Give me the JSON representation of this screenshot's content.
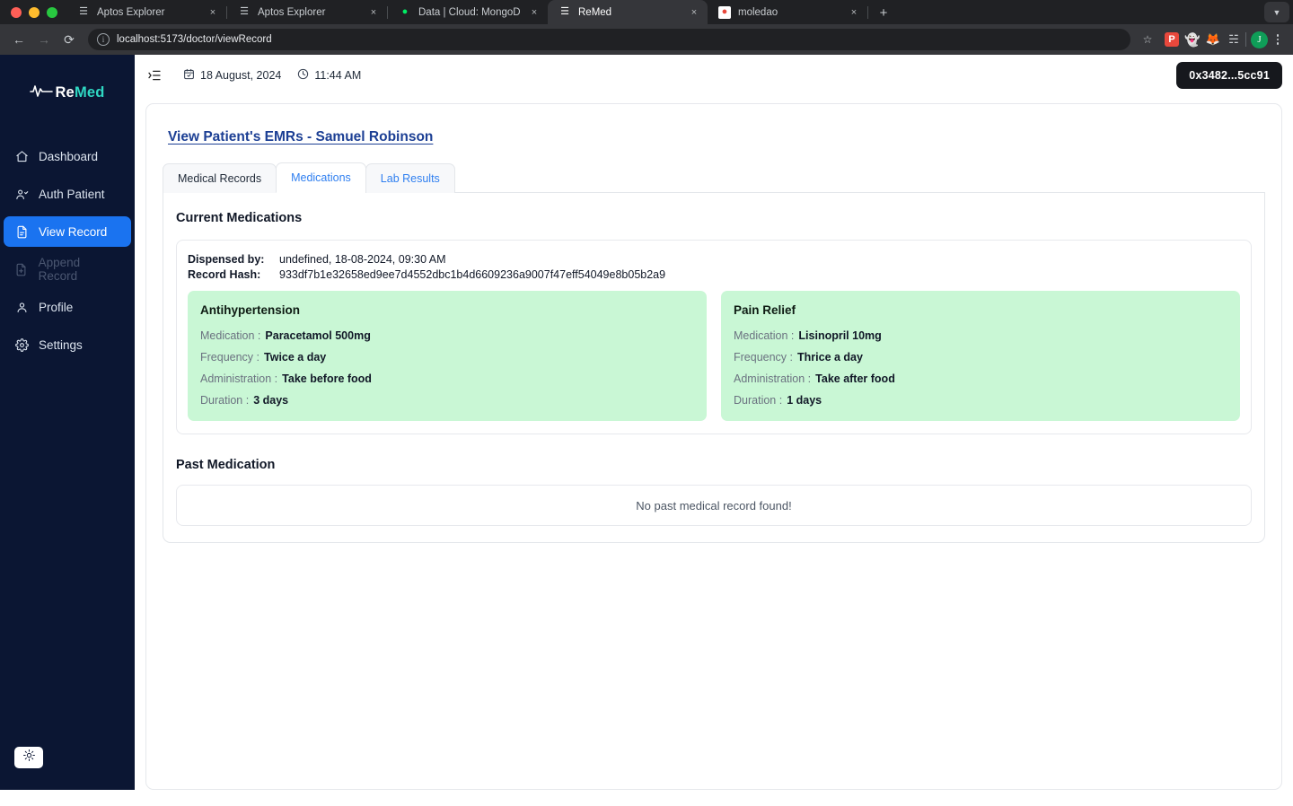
{
  "browser": {
    "tabs": [
      {
        "title": "Aptos Explorer",
        "favicon": "aptos-icon",
        "active": false
      },
      {
        "title": "Aptos Explorer",
        "favicon": "aptos-icon",
        "active": false
      },
      {
        "title": "Data | Cloud: MongoDB Clou",
        "favicon": "mongodb-icon",
        "active": false
      },
      {
        "title": "ReMed",
        "favicon": "aptos-icon",
        "active": true
      },
      {
        "title": "moledao",
        "favicon": "moledao-icon",
        "active": false
      }
    ],
    "new_tab_label": "+",
    "close_label": "×",
    "tab_list_label": "⌄",
    "back_label": "←",
    "forward_label": "→",
    "reload_label": "⟳",
    "url": "localhost:5173/doctor/viewRecord",
    "site_info_label": "i",
    "star_label": "☆",
    "profile_initial": "J",
    "extensions": [
      "pocket-icon",
      "ghost-icon",
      "fox-icon",
      "puzzle-icon"
    ]
  },
  "sidebar": {
    "logo": {
      "re": "Re",
      "med": "Med"
    },
    "items": [
      {
        "label": "Dashboard",
        "icon": "home-icon",
        "state": "normal"
      },
      {
        "label": "Auth Patient",
        "icon": "user-check-icon",
        "state": "normal"
      },
      {
        "label": "View Record",
        "icon": "file-text-icon",
        "state": "active"
      },
      {
        "label": "Append Record",
        "icon": "file-add-icon",
        "state": "disabled"
      },
      {
        "label": "Profile",
        "icon": "user-icon",
        "state": "normal"
      },
      {
        "label": "Settings",
        "icon": "gear-icon",
        "state": "normal"
      }
    ],
    "theme_toggle_icon": "sun-icon"
  },
  "topbar": {
    "sidebar_toggle_icon": "list-collapse-icon",
    "date_icon": "calendar-icon",
    "date": "18 August, 2024",
    "time_icon": "clock-icon",
    "time": "11:44 AM",
    "wallet": "0x3482...5cc91"
  },
  "page": {
    "title": "View Patient's EMRs - Samuel Robinson",
    "tabs": [
      {
        "label": "Medical Records",
        "style": "dark"
      },
      {
        "label": "Medications",
        "style": "active"
      },
      {
        "label": "Lab Results",
        "style": "blue"
      }
    ],
    "current_section_title": "Current Medications",
    "record": {
      "dispensed_by_label": "Dispensed by:",
      "dispensed_by_value": "undefined, 18-08-2024, 09:30 AM",
      "record_hash_label": "Record Hash:",
      "record_hash_value": "933df7b1e32658ed9ee7d4552dbc1b4d6609236a9007f47eff54049e8b05b2a9"
    },
    "medications": [
      {
        "title": "Antihypertension",
        "medication_label": "Medication :",
        "medication": "Paracetamol 500mg",
        "frequency_label": "Frequency :",
        "frequency": "Twice a day",
        "administration_label": "Administration :",
        "administration": "Take before food",
        "duration_label": "Duration :",
        "duration": "3 days"
      },
      {
        "title": "Pain Relief",
        "medication_label": "Medication :",
        "medication": "Lisinopril 10mg",
        "frequency_label": "Frequency :",
        "frequency": "Thrice a day",
        "administration_label": "Administration :",
        "administration": "Take after food",
        "duration_label": "Duration :",
        "duration": "1 days"
      }
    ],
    "past_section_title": "Past Medication",
    "past_empty_text": "No past medical record found!"
  },
  "colors": {
    "sidebar_bg": "#0b1633",
    "accent_blue": "#1a73f0",
    "logo_teal": "#2fd8c3",
    "med_card_green": "#c9f7d5",
    "title_blue": "#1c3f94",
    "tab_blue": "#2f7ff0"
  }
}
